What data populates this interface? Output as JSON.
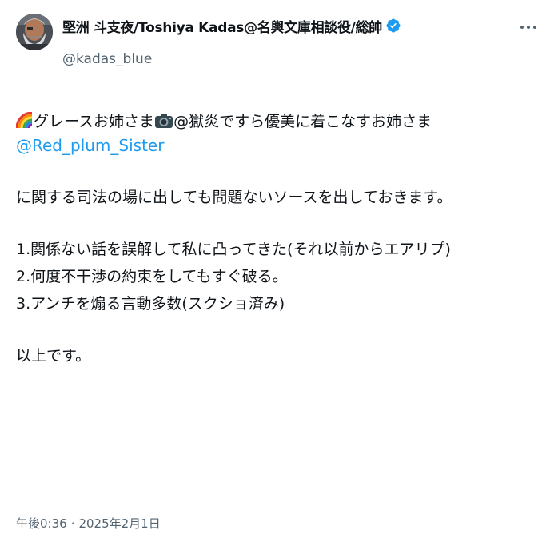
{
  "tweet": {
    "author": {
      "display_name": "堅洲 斗支夜/Toshiya Kadas@名輿文庫相談役/総帥",
      "handle": "@kadas_blue",
      "avatar_icon": "bearded-man-avatar",
      "verified_icon": "verified-badge-icon"
    },
    "more_icon": "more-options-icon",
    "text": {
      "line1_a": "グレースお姉さま",
      "line1_b": "@獄炎ですら優美に着こなすお姉さま",
      "mention": "@Red_plum_Sister",
      "sentence": "に関する司法の場に出しても問題ないソースを出しておきます。",
      "item1": "1.関係ない話を誤解して私に凸ってきた(それ以前からエアリプ)",
      "item2": "2.何度不干渉の約束をしてもすぐ破る。",
      "item3": "3.アンチを煽る言動多数(スクショ済み)",
      "closing": "以上です。"
    },
    "emojis": [
      "rainbow-icon",
      "camera-icon"
    ],
    "timestamp": {
      "time": "午後0:36",
      "separator": "·",
      "date": "2025年2月1日"
    },
    "colors": {
      "link": "#1d9bf0",
      "secondary": "#536471",
      "text": "#0f1419",
      "verified": "#1d9bf0"
    }
  }
}
